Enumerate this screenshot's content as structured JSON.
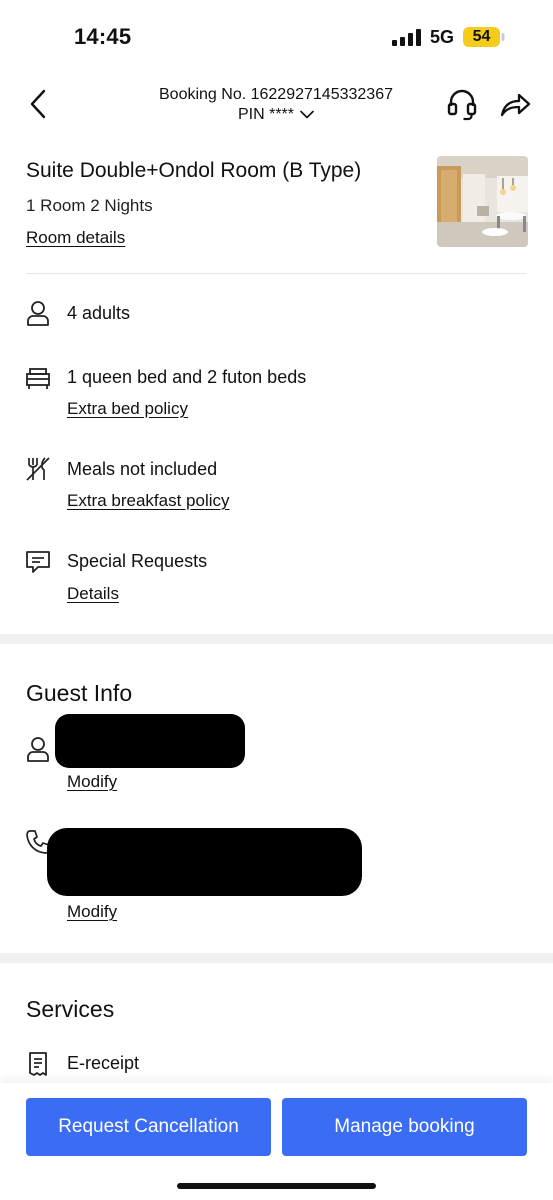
{
  "status_bar": {
    "time": "14:45",
    "network": "5G",
    "battery": "54",
    "battery_color": "#f5cc1a"
  },
  "header": {
    "booking_number": "Booking No. 1622927145332367",
    "pin": "PIN ****",
    "back_icon": "chevron-left-icon",
    "support_icon": "headset-icon",
    "share_icon": "share-arrow-icon"
  },
  "room": {
    "title": "Suite Double+Ondol Room (B Type)",
    "summary": "1 Room 2 Nights",
    "details_link": "Room details"
  },
  "features": [
    {
      "icon": "person-icon",
      "text": "4 adults"
    },
    {
      "icon": "bed-icon",
      "text": "1 queen bed and 2 futon beds",
      "link": "Extra bed policy"
    },
    {
      "icon": "no-meal-icon",
      "text": "Meals not included",
      "link": "Extra breakfast policy"
    },
    {
      "icon": "message-icon",
      "text": "Special Requests",
      "link": "Details"
    }
  ],
  "guest_info": {
    "title": "Guest Info",
    "name_modify": "Modify",
    "phone_modify": "Modify"
  },
  "services": {
    "title": "Services",
    "items": [
      {
        "icon": "receipt-icon",
        "label": "E-receipt"
      }
    ]
  },
  "actions": {
    "cancel": "Request Cancellation",
    "manage": "Manage booking",
    "accent_color": "#3a6cf4"
  }
}
